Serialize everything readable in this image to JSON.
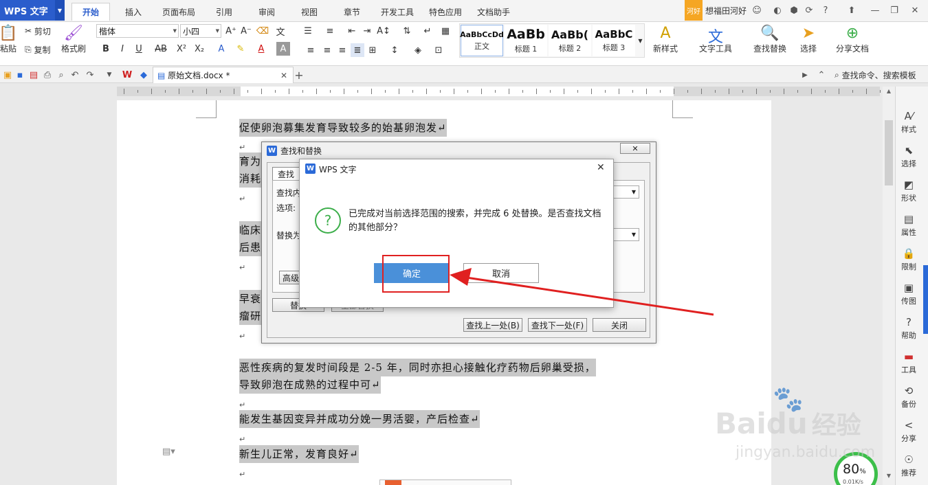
{
  "app": {
    "title": "WPS 文字",
    "user_badge": "河好",
    "user_name": "想福田河好"
  },
  "menu": {
    "tabs": [
      "开始",
      "插入",
      "页面布局",
      "引用",
      "审阅",
      "视图",
      "章节",
      "开发工具",
      "特色应用",
      "文档助手"
    ],
    "active": "开始"
  },
  "ribbon": {
    "paste": "粘贴",
    "cut": "剪切",
    "copy": "复制",
    "format_painter": "格式刷",
    "font_name": "楷体",
    "font_size": "小四",
    "styles": [
      {
        "sample": "AaBbCcDd",
        "label": "正文"
      },
      {
        "sample": "AaBb",
        "label": "标题 1"
      },
      {
        "sample": "AaBb(",
        "label": "标题 2"
      },
      {
        "sample": "AaBbC",
        "label": "标题 3"
      }
    ],
    "new_style": "新样式",
    "text_tools": "文字工具",
    "find_replace": "查找替换",
    "select": "选择",
    "share_doc": "分享文档"
  },
  "doc_tab": {
    "name": "原始文档.docx *"
  },
  "search_box": {
    "placeholder": "查找命令、搜索模板"
  },
  "document": {
    "paragraphs": [
      "促使卵泡募集发育导致较多的始基卵泡发",
      "育为",
      "消耗",
      "临床",
      "后患",
      "早衰",
      "瘤研",
      "恶性疾病的复发时间段是 2-5 年，同时亦担心接触化疗药物后卵巢受损，",
      "导致卵泡在成熟的过程中可",
      "能发生基因变异并成功分娩一男活婴，产后检查",
      "新生儿正常，发育良好"
    ]
  },
  "find_dialog": {
    "title": "查找和替换",
    "tab_find": "查找",
    "find_label": "查找内",
    "options_label": "选项:",
    "replace_label": "替换为",
    "advanced_btn": "高级",
    "replace_btn": "替换",
    "replace_all_btn": "全部替换",
    "find_prev": "查找上一处(B)",
    "find_next": "查找下一处(F)",
    "close": "关闭"
  },
  "message_dialog": {
    "title": "WPS 文字",
    "text": "已完成对当前选择范围的搜索，并完成 6 处替换。是否查找文档的其他部分？",
    "ok": "确定",
    "cancel": "取消"
  },
  "right_sidebar": {
    "items": [
      "样式",
      "选择",
      "形状",
      "属性",
      "限制",
      "传图",
      "帮助",
      "工具",
      "备份",
      "分享",
      "推荐"
    ]
  },
  "speed_widget": {
    "percent": "80",
    "unit": "%",
    "rate": "0.01K/s"
  },
  "watermark": {
    "brand": "Bai",
    "brand2": "du",
    "cn": "经验",
    "url": "jingyan.baidu.com"
  },
  "colors": {
    "accent": "#2b5dcc",
    "ok_button": "#4a90d9",
    "highlight_frame": "#e02020",
    "arrow": "#e02020",
    "selection": "#c8c8c8"
  }
}
